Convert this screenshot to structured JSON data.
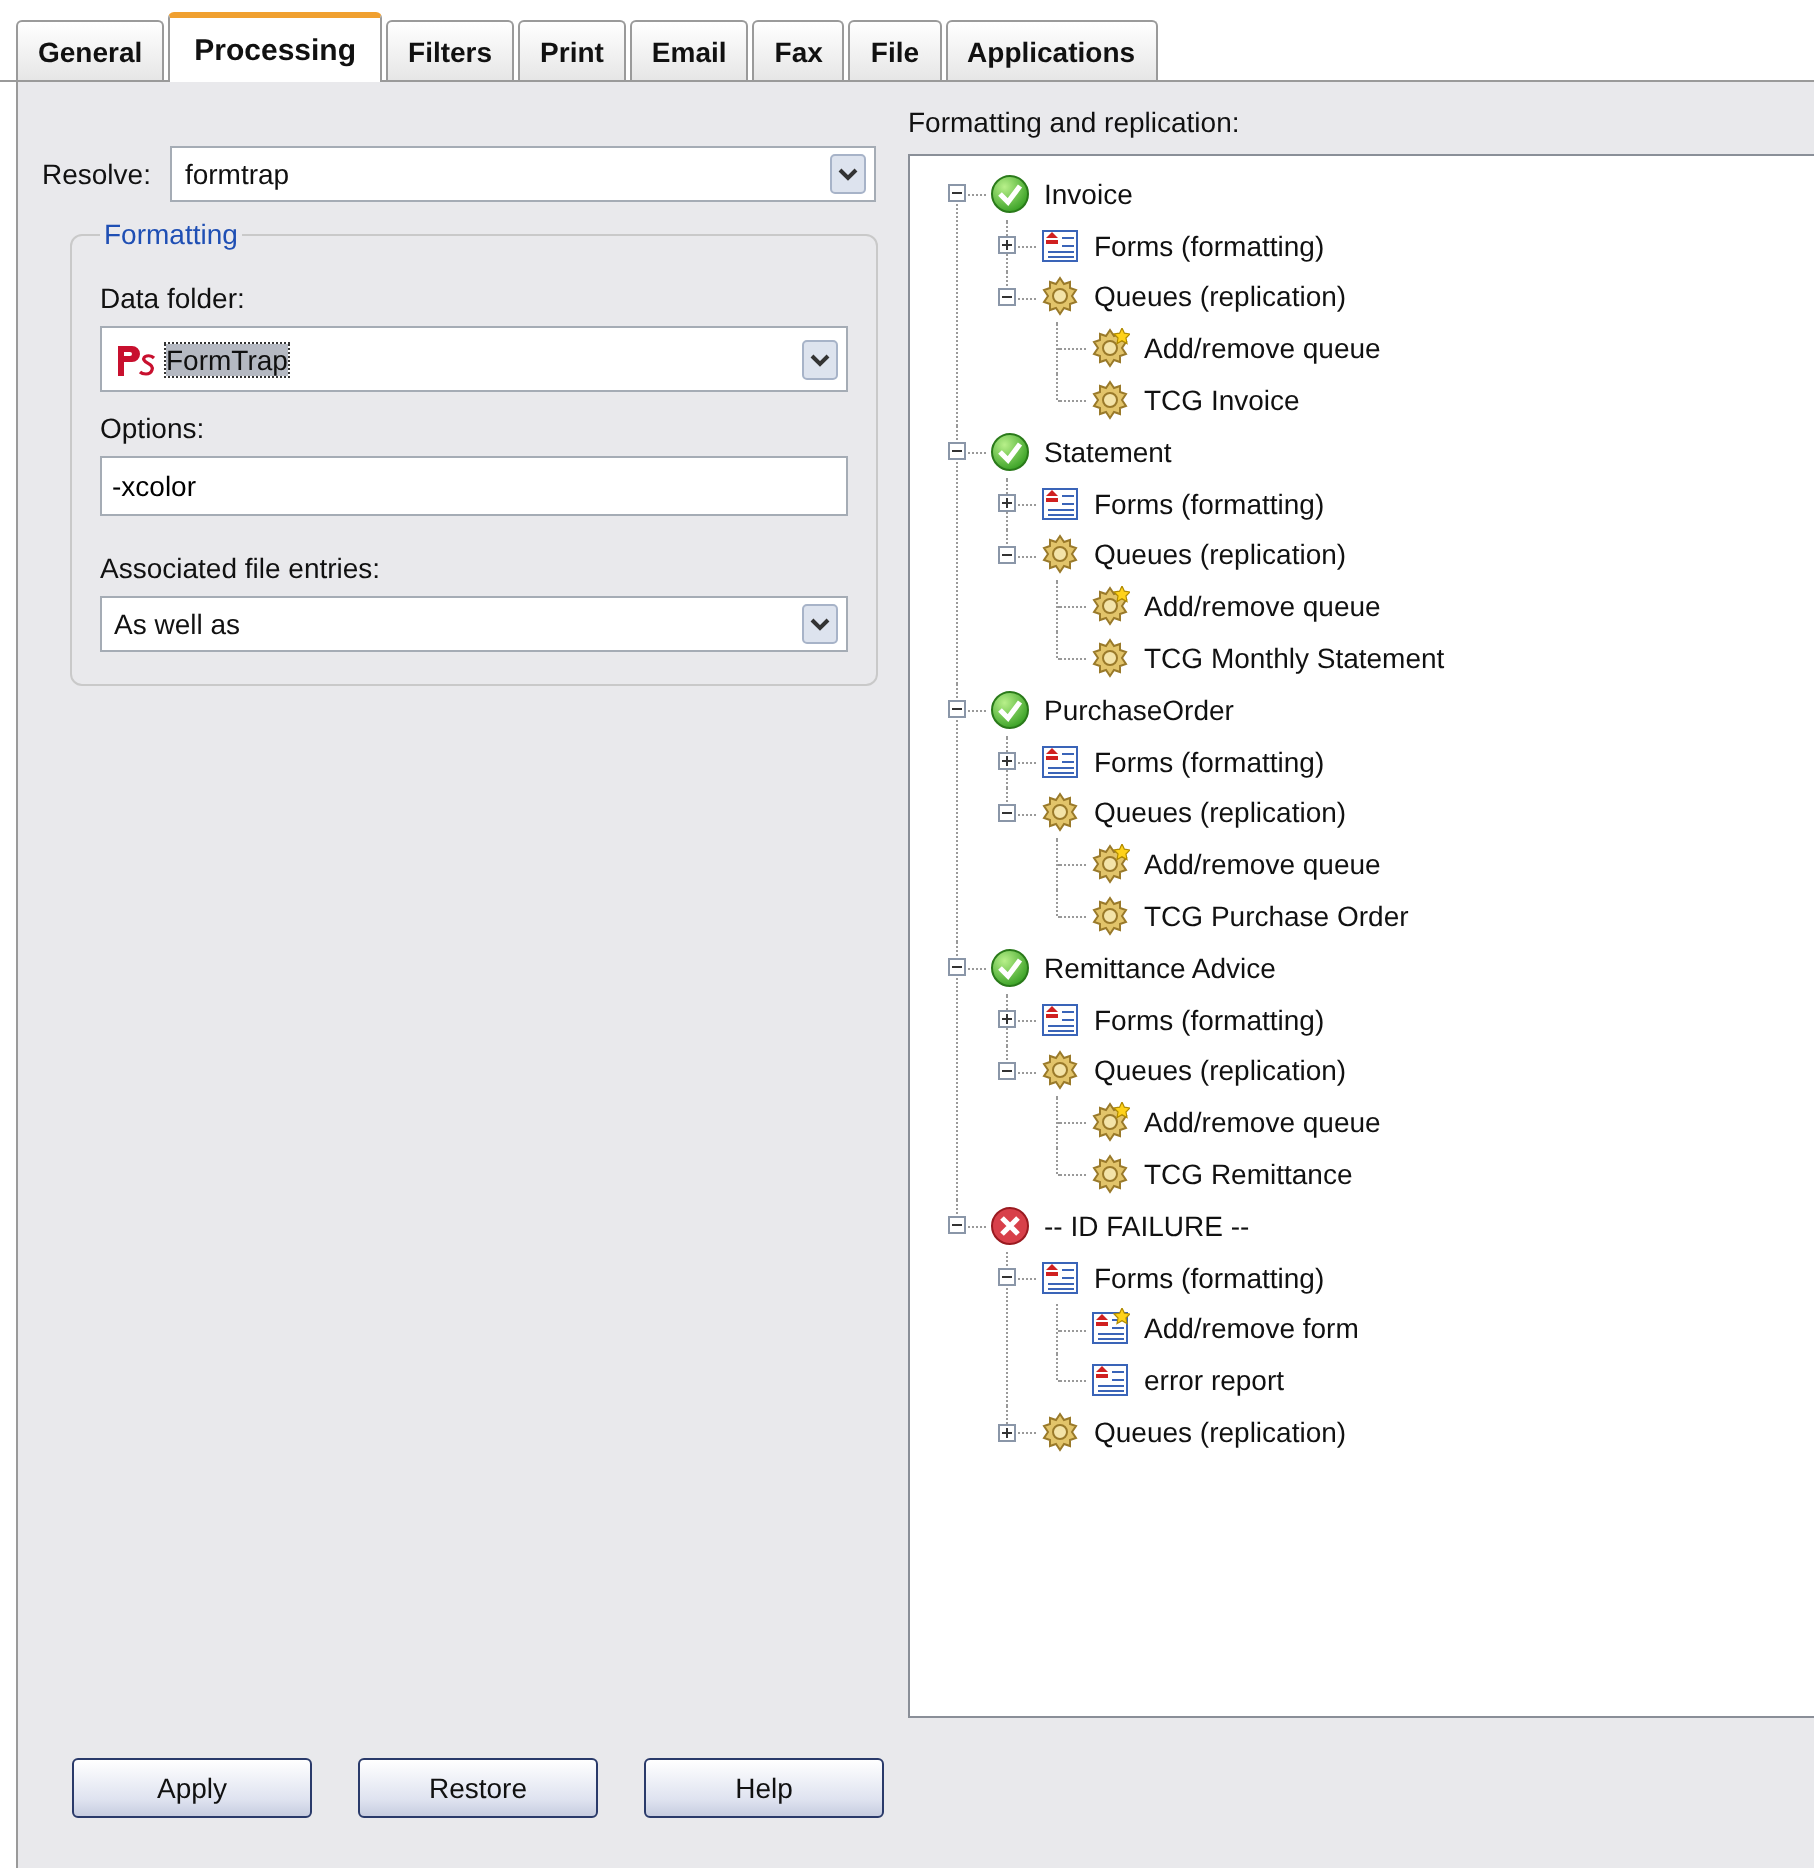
{
  "tabs": [
    {
      "label": "General",
      "selected": false
    },
    {
      "label": "Processing",
      "selected": true
    },
    {
      "label": "Filters",
      "selected": false
    },
    {
      "label": "Print",
      "selected": false
    },
    {
      "label": "Email",
      "selected": false
    },
    {
      "label": "Fax",
      "selected": false
    },
    {
      "label": "File",
      "selected": false
    },
    {
      "label": "Applications",
      "selected": false
    }
  ],
  "resolve": {
    "label": "Resolve:",
    "value": "formtrap"
  },
  "formatting": {
    "title": "Formatting",
    "data_folder": {
      "label": "Data folder:",
      "value": "FormTrap",
      "highlighted": true
    },
    "options": {
      "label": "Options:",
      "value": "-xcolor"
    },
    "associated": {
      "label": "Associated file entries:",
      "value": "As well as"
    }
  },
  "tree": {
    "label": "Formatting and replication:",
    "nodes": [
      {
        "kind": "ok",
        "label": "Invoice",
        "expanded": true,
        "children": [
          {
            "kind": "forms",
            "label": "Forms (formatting)",
            "expanded": false
          },
          {
            "kind": "queues",
            "label": "Queues (replication)",
            "expanded": true,
            "children": [
              {
                "kind": "add-queue",
                "label": "Add/remove queue"
              },
              {
                "kind": "queue",
                "label": "TCG Invoice"
              }
            ]
          }
        ]
      },
      {
        "kind": "ok",
        "label": "Statement",
        "expanded": true,
        "children": [
          {
            "kind": "forms",
            "label": "Forms (formatting)",
            "expanded": false
          },
          {
            "kind": "queues",
            "label": "Queues (replication)",
            "expanded": true,
            "children": [
              {
                "kind": "add-queue",
                "label": "Add/remove queue"
              },
              {
                "kind": "queue",
                "label": "TCG Monthly Statement"
              }
            ]
          }
        ]
      },
      {
        "kind": "ok",
        "label": "PurchaseOrder",
        "expanded": true,
        "children": [
          {
            "kind": "forms",
            "label": "Forms (formatting)",
            "expanded": false
          },
          {
            "kind": "queues",
            "label": "Queues (replication)",
            "expanded": true,
            "children": [
              {
                "kind": "add-queue",
                "label": "Add/remove queue"
              },
              {
                "kind": "queue",
                "label": "TCG Purchase Order"
              }
            ]
          }
        ]
      },
      {
        "kind": "ok",
        "label": "Remittance Advice",
        "expanded": true,
        "children": [
          {
            "kind": "forms",
            "label": "Forms (formatting)",
            "expanded": false
          },
          {
            "kind": "queues",
            "label": "Queues (replication)",
            "expanded": true,
            "children": [
              {
                "kind": "add-queue",
                "label": "Add/remove queue"
              },
              {
                "kind": "queue",
                "label": "TCG Remittance"
              }
            ]
          }
        ]
      },
      {
        "kind": "error",
        "label": "-- ID FAILURE --",
        "expanded": true,
        "children": [
          {
            "kind": "forms",
            "label": "Forms (formatting)",
            "expanded": true,
            "children": [
              {
                "kind": "add-form",
                "label": "Add/remove form"
              },
              {
                "kind": "form",
                "label": "error report"
              }
            ]
          },
          {
            "kind": "queues",
            "label": "Queues (replication)",
            "expanded": false
          }
        ]
      }
    ]
  },
  "buttons": [
    "Apply",
    "Restore",
    "Help"
  ]
}
